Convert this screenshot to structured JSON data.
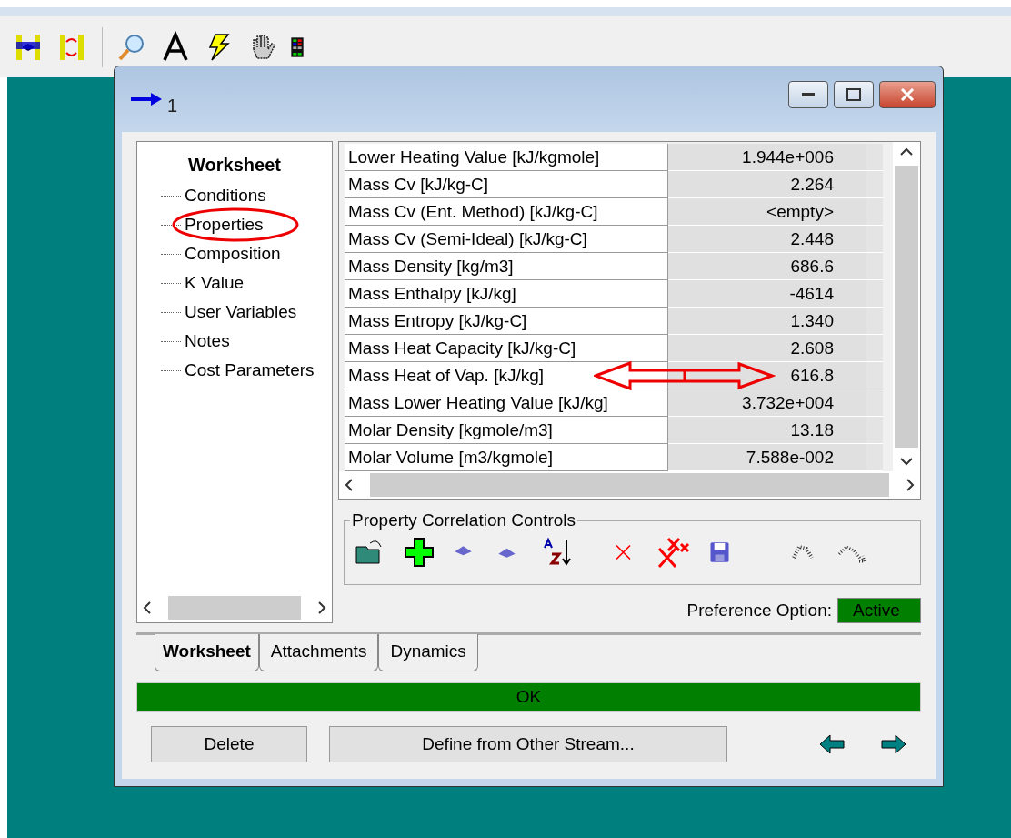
{
  "window": {
    "title": "1"
  },
  "sidebar": {
    "title": "Worksheet",
    "items": [
      {
        "label": "Conditions",
        "circled": false
      },
      {
        "label": "Properties",
        "circled": true
      },
      {
        "label": "Composition",
        "circled": false
      },
      {
        "label": "K Value",
        "circled": false
      },
      {
        "label": "User Variables",
        "circled": false
      },
      {
        "label": "Notes",
        "circled": false
      },
      {
        "label": "Cost Parameters",
        "circled": false
      }
    ]
  },
  "table": {
    "rows": [
      {
        "name": "Lower Heating Value [kJ/kgmole]",
        "value": "1.944e+006",
        "arrowed": false
      },
      {
        "name": "Mass Cv [kJ/kg-C]",
        "value": "2.264",
        "arrowed": false
      },
      {
        "name": "Mass Cv (Ent. Method) [kJ/kg-C]",
        "value": "<empty>",
        "arrowed": false
      },
      {
        "name": "Mass Cv (Semi-Ideal) [kJ/kg-C]",
        "value": "2.448",
        "arrowed": false
      },
      {
        "name": "Mass Density [kg/m3]",
        "value": "686.6",
        "arrowed": false
      },
      {
        "name": "Mass Enthalpy [kJ/kg]",
        "value": "-4614",
        "arrowed": false
      },
      {
        "name": "Mass Entropy [kJ/kg-C]",
        "value": "1.340",
        "arrowed": false
      },
      {
        "name": "Mass Heat Capacity [kJ/kg-C]",
        "value": "2.608",
        "arrowed": false
      },
      {
        "name": "Mass Heat of Vap. [kJ/kg]",
        "value": "616.8",
        "arrowed": true
      },
      {
        "name": "Mass Lower Heating Value [kJ/kg]",
        "value": "3.732e+004",
        "arrowed": false
      },
      {
        "name": "Molar Density [kgmole/m3]",
        "value": "13.18",
        "arrowed": false
      },
      {
        "name": "Molar Volume [m3/kgmole]",
        "value": "7.588e-002",
        "arrowed": false
      }
    ]
  },
  "controls": {
    "title": "Property Correlation Controls"
  },
  "preference": {
    "label": "Preference Option:",
    "value": "Active"
  },
  "tabs": [
    {
      "label": "Worksheet",
      "selected": true
    },
    {
      "label": "Attachments",
      "selected": false
    },
    {
      "label": "Dynamics",
      "selected": false
    }
  ],
  "status": "OK",
  "buttons": [
    "Delete",
    "Define from Other Stream..."
  ]
}
